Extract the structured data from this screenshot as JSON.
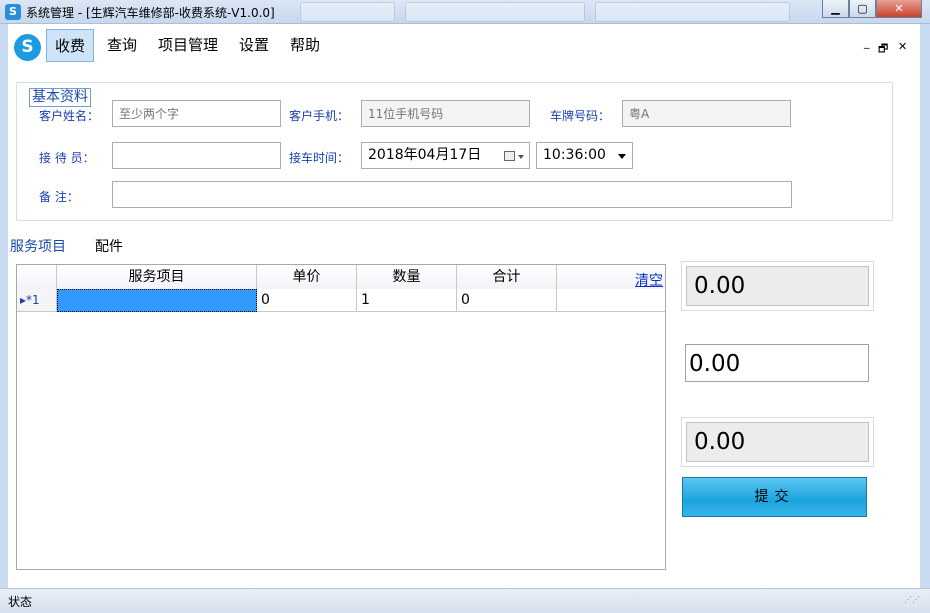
{
  "window": {
    "title": "系统管理 - [生辉汽车维修部-收费系统-V1.0.0]",
    "icon_letter": "S"
  },
  "menu": {
    "logo_letter": "S",
    "items": [
      {
        "label": "收费",
        "active": true
      },
      {
        "label": "查询",
        "active": false
      },
      {
        "label": "项目管理",
        "active": false
      },
      {
        "label": "设置",
        "active": false
      },
      {
        "label": "帮助",
        "active": false
      }
    ],
    "mdi_controls": [
      "_",
      "🗗",
      "✕"
    ]
  },
  "basic_info": {
    "legend": "基本资料",
    "customer_name_label": "客户姓名：",
    "customer_name_placeholder": "至少两个字",
    "customer_phone_label": "客户手机：",
    "customer_phone_placeholder": "11位手机号码",
    "plate_label": "车牌号码：",
    "plate_placeholder": "粤A",
    "receptionist_label": "接 待 员：",
    "receptionist_value": "",
    "pickup_time_label": "接车时间：",
    "pickup_date": "2018年04月17日",
    "pickup_time": "10:36:00",
    "remarks_label": "备    注：",
    "remarks_value": ""
  },
  "tabs": [
    {
      "label": "服务项目",
      "active": true
    },
    {
      "label": "配件",
      "active": false
    }
  ],
  "grid": {
    "columns": [
      "服务项目",
      "单价",
      "数量",
      "合计"
    ],
    "clear_label": "清空",
    "rows": [
      {
        "row_header": "▸*1",
        "service": "",
        "price": "0",
        "quantity": "1",
        "total": "0"
      }
    ]
  },
  "totals": {
    "box1": "0.00",
    "box2": "0.00",
    "box3": "0.00"
  },
  "submit_label": "提交",
  "status": {
    "text": "状态"
  }
}
